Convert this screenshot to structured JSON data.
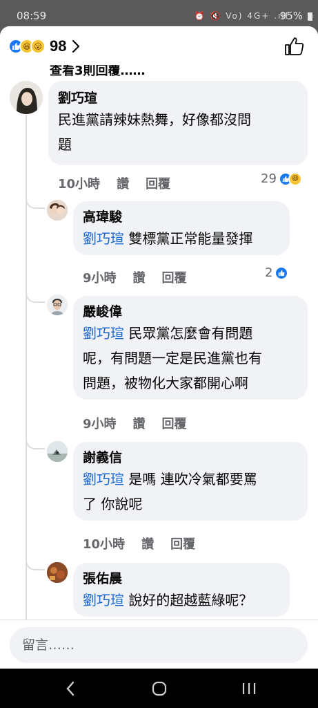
{
  "status_bar": {
    "time": "08:59",
    "icons": "⏰ 🔇 Vo) 4G+ .ıll",
    "battery": "95%"
  },
  "header": {
    "reaction_icons": [
      "like-icon",
      "haha-icon",
      "wow-icon"
    ],
    "reaction_count": "98",
    "like_button_icon": "thumbs-up-icon"
  },
  "partial_text": "查看3則回覆……",
  "comments": [
    {
      "author": "劉巧瑄",
      "text_lines": [
        "民進黨請辣妹熱舞，好像都沒問",
        "題"
      ],
      "time": "10小時",
      "like": "讚",
      "reply": "回覆",
      "reactions": "29",
      "reaction_icons": [
        "like-icon",
        "haha-icon"
      ]
    },
    {
      "author": "高瑋駿",
      "mention": "劉巧瑄",
      "text_lines": [
        " 雙標黨正常能量發揮"
      ],
      "time": "9小時",
      "like": "讚",
      "reply": "回覆",
      "reactions": "2",
      "reaction_icons": [
        "like-icon"
      ]
    },
    {
      "author": "嚴峻偉",
      "mention": "劉巧瑄",
      "text_lines": [
        " 民眾黨怎麼會有問題",
        "呢，有問題一定是民進黨也有",
        "問題，被物化大家都開心啊"
      ],
      "time": "9小時",
      "like": "讚",
      "reply": "回覆"
    },
    {
      "author": "謝義信",
      "mention": "劉巧瑄",
      "text_lines": [
        " 是嗎 連吹冷氣都要罵",
        "了  你說呢"
      ],
      "time": "10小時",
      "like": "讚",
      "reply": "回覆"
    },
    {
      "author": "張佑晨",
      "mention": "劉巧瑄",
      "text_lines": [
        " 說好的超越藍綠呢？"
      ]
    }
  ],
  "composer": {
    "placeholder": "留言……"
  },
  "nav": {
    "back_icon": "back-chevron-icon",
    "home_icon": "home-circle-icon",
    "recents_icon": "recents-bars-icon"
  }
}
